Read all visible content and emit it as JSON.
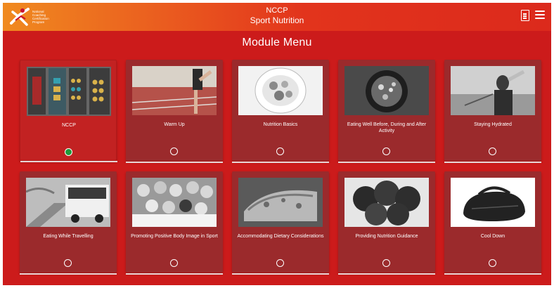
{
  "header": {
    "logo_text": "National\nCoaching\nCertification\nProgram",
    "title_line1": "NCCP",
    "title_line2": "Sport Nutrition"
  },
  "page": {
    "title": "Module Menu"
  },
  "colors": {
    "background": "#cc1b1b",
    "card": "#9b2a2c",
    "complete": "#1e9a3a"
  },
  "modules": [
    {
      "label": "NCCP",
      "status": "complete"
    },
    {
      "label": "Warm Up",
      "status": "incomplete"
    },
    {
      "label": "Nutrition Basics",
      "status": "incomplete"
    },
    {
      "label": "Eating Well Before, During and After Activity",
      "status": "incomplete"
    },
    {
      "label": "Staying Hydrated",
      "status": "incomplete"
    },
    {
      "label": "Eating While Travelling",
      "status": "incomplete"
    },
    {
      "label": "Promoting Positive Body Image in Sport",
      "status": "incomplete"
    },
    {
      "label": "Accommodating Dietary Considerations",
      "status": "incomplete"
    },
    {
      "label": "Providing Nutrition Guidance",
      "status": "incomplete"
    },
    {
      "label": "Cool Down",
      "status": "incomplete"
    }
  ]
}
